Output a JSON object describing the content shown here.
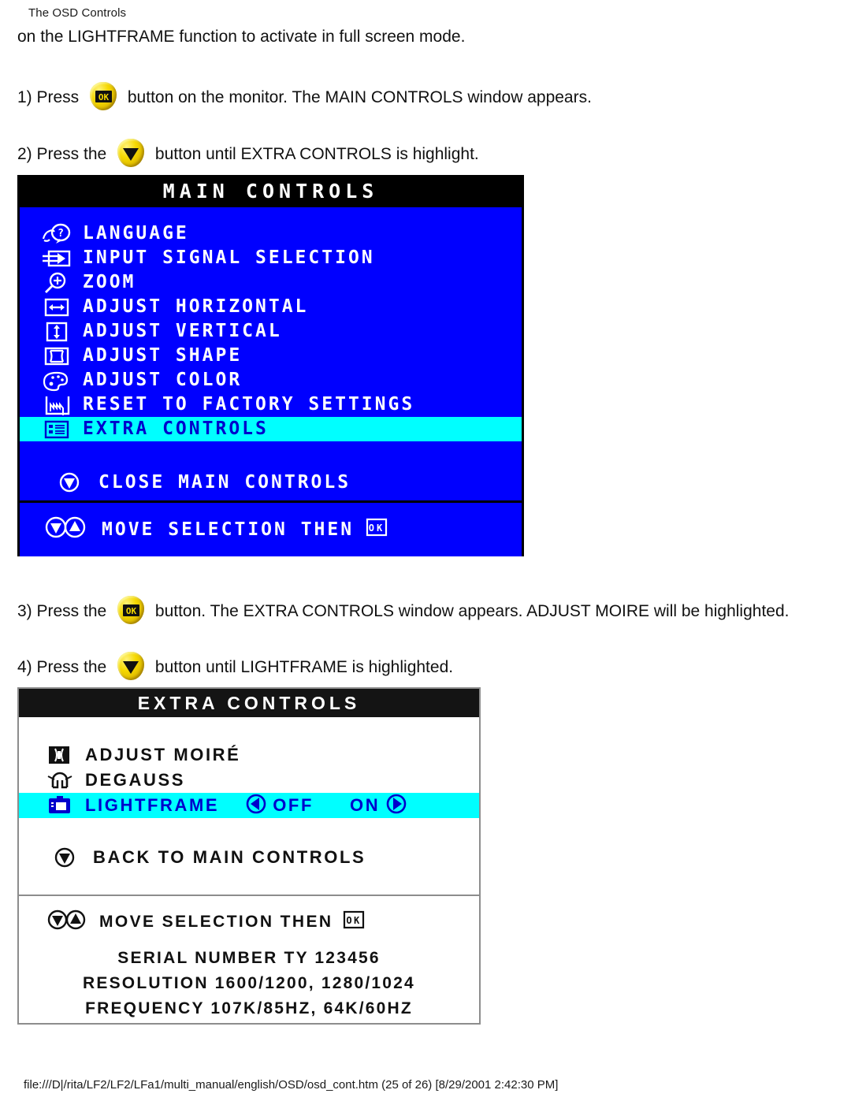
{
  "document": {
    "header": "The OSD Controls",
    "footer": "file:///D|/rita/LF2/LF2/LFa1/multi_manual/english/OSD/osd_cont.htm (25 of 26) [8/29/2001 2:42:30 PM]"
  },
  "instructions": {
    "intro": "on the LIGHTFRAME function to activate in full screen mode.",
    "step1_pre": "1) Press",
    "step1_post": "button on the monitor. The MAIN CONTROLS window appears.",
    "step2_pre": "2) Press the",
    "step2_post": "button until EXTRA CONTROLS is highlight.",
    "step3_pre": "3) Press the",
    "step3_post": "button. The EXTRA CONTROLS window appears. ADJUST MOIRE will be highlighted.",
    "step4_pre": "4) Press the",
    "step4_post": "button until LIGHTFRAME is highlighted."
  },
  "icons": {
    "ok_button": "ok-button-icon",
    "down_button": "down-arrow-button-icon"
  },
  "main_controls": {
    "title": "MAIN CONTROLS",
    "items": [
      {
        "icon": "language-icon",
        "label": "LANGUAGE",
        "highlighted": false
      },
      {
        "icon": "input-signal-icon",
        "label": "INPUT SIGNAL SELECTION",
        "highlighted": false
      },
      {
        "icon": "zoom-icon",
        "label": "ZOOM",
        "highlighted": false
      },
      {
        "icon": "horizontal-icon",
        "label": "ADJUST HORIZONTAL",
        "highlighted": false
      },
      {
        "icon": "vertical-icon",
        "label": "ADJUST VERTICAL",
        "highlighted": false
      },
      {
        "icon": "shape-icon",
        "label": "ADJUST SHAPE",
        "highlighted": false
      },
      {
        "icon": "color-icon",
        "label": "ADJUST COLOR",
        "highlighted": false
      },
      {
        "icon": "factory-reset-icon",
        "label": "RESET TO FACTORY SETTINGS",
        "highlighted": false
      },
      {
        "icon": "extra-controls-icon",
        "label": "EXTRA CONTROLS",
        "highlighted": true
      }
    ],
    "close_item": {
      "icon": "close-arrow-icon",
      "label": "CLOSE MAIN CONTROLS"
    },
    "footer_hint": "MOVE SELECTION THEN",
    "colors": {
      "background": "#0000ff",
      "highlight": "#00ffff",
      "titlebar": "#000000",
      "text": "#ffffff"
    }
  },
  "extra_controls": {
    "title": "EXTRA CONTROLS",
    "items": [
      {
        "icon": "moire-icon",
        "label": "ADJUST MOIRÉ",
        "highlighted": false
      },
      {
        "icon": "degauss-icon",
        "label": "DEGAUSS",
        "highlighted": false
      },
      {
        "icon": "lightframe-icon",
        "label": "LIGHTFRAME",
        "highlighted": true,
        "options": {
          "off": "OFF",
          "on": "ON",
          "selected": "OFF"
        }
      }
    ],
    "back_item": {
      "icon": "back-arrow-icon",
      "label": "BACK TO MAIN CONTROLS"
    },
    "footer_hint": "MOVE SELECTION THEN",
    "info": {
      "serial": "SERIAL NUMBER TY 123456",
      "resolution": "RESOLUTION 1600/1200, 1280/1024",
      "frequency": "FREQUENCY 107K/85HZ, 64K/60HZ"
    },
    "colors": {
      "background": "#ffffff",
      "highlight": "#00ffff",
      "titlebar": "#141414",
      "text": "#111111"
    }
  }
}
